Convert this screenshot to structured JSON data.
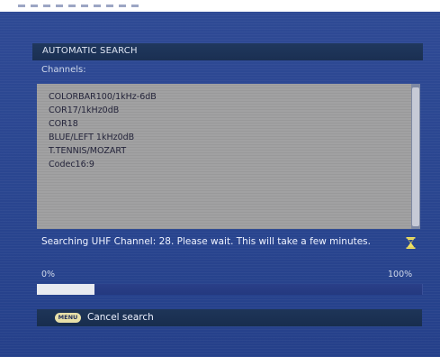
{
  "dialog": {
    "title": "AUTOMATIC SEARCH",
    "channels_label": "Channels:",
    "channels": [
      "COLORBAR100/1kHz-6dB",
      "COR17/1kHz0dB",
      "COR18",
      "BLUE/LEFT 1kHz0dB",
      "T.TENNIS/MOZART",
      "Codec16:9"
    ],
    "status": "Searching UHF Channel: 28. Please wait. This will take a few minutes.",
    "progress": {
      "start_label": "0%",
      "end_label": "100%",
      "fraction": 0.15
    },
    "footer": {
      "menu_key_label": "MENU",
      "cancel_label": "Cancel search"
    }
  },
  "colors": {
    "background": "#2a4690",
    "title_bar": "#1a2f52",
    "list_background": "#a1a1a2",
    "progress_fill": "#e9ebf0",
    "hourglass": "#f0e060"
  },
  "icons": {
    "status_icon": "hourglass-icon",
    "menu_key": "menu-key-icon"
  }
}
